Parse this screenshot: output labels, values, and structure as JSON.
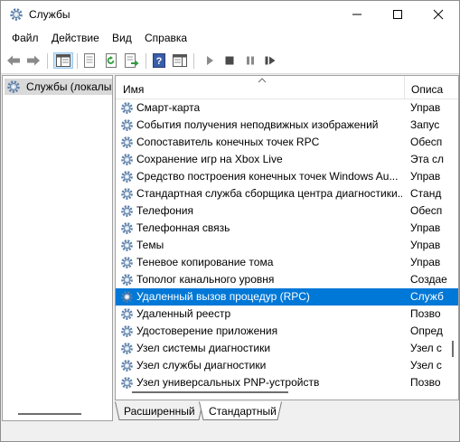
{
  "window": {
    "title": "Службы"
  },
  "menu": [
    "Файл",
    "Действие",
    "Вид",
    "Справка"
  ],
  "toolbar": {
    "icons": [
      "back-icon",
      "forward-icon",
      "show-hide-console-tree-icon",
      "properties-icon",
      "refresh-icon",
      "export-list-icon",
      "help-icon",
      "show-hide-action-pane-icon",
      "start-service-icon",
      "stop-service-icon",
      "pause-service-icon",
      "restart-service-icon"
    ]
  },
  "tree": {
    "item": "Службы (локалы"
  },
  "list": {
    "columns": {
      "name": "Имя",
      "description": "Описа"
    },
    "rows": [
      {
        "name": "Смарт-карта",
        "desc": "Управ"
      },
      {
        "name": "События получения неподвижных изображений",
        "desc": "Запус"
      },
      {
        "name": "Сопоставитель конечных точек RPC",
        "desc": "Обесп"
      },
      {
        "name": "Сохранение игр на Xbox Live",
        "desc": "Эта сл"
      },
      {
        "name": "Средство построения конечных точек Windows Au...",
        "desc": "Управ"
      },
      {
        "name": "Стандартная служба сборщика центра диагностики...",
        "desc": "Станд"
      },
      {
        "name": "Телефония",
        "desc": "Обесп"
      },
      {
        "name": "Телефонная связь",
        "desc": "Управ"
      },
      {
        "name": "Темы",
        "desc": "Управ"
      },
      {
        "name": "Теневое копирование тома",
        "desc": "Управ"
      },
      {
        "name": "Тополог канального уровня",
        "desc": "Создае"
      },
      {
        "name": "Удаленный вызов процедур (RPC)",
        "desc": "Служб"
      },
      {
        "name": "Удаленный реестр",
        "desc": "Позво"
      },
      {
        "name": "Удостоверение приложения",
        "desc": "Опред"
      },
      {
        "name": "Узел системы диагностики",
        "desc": "Узел с"
      },
      {
        "name": "Узел службы диагностики",
        "desc": "Узел с"
      },
      {
        "name": "Узел универсальных PNP-устройств",
        "desc": "Позво"
      }
    ],
    "selected_index": 11
  },
  "tabs": [
    "Расширенный",
    "Стандартный"
  ],
  "colors": {
    "selection": "#0078d7",
    "toolbar_active": "#cce4f7"
  }
}
